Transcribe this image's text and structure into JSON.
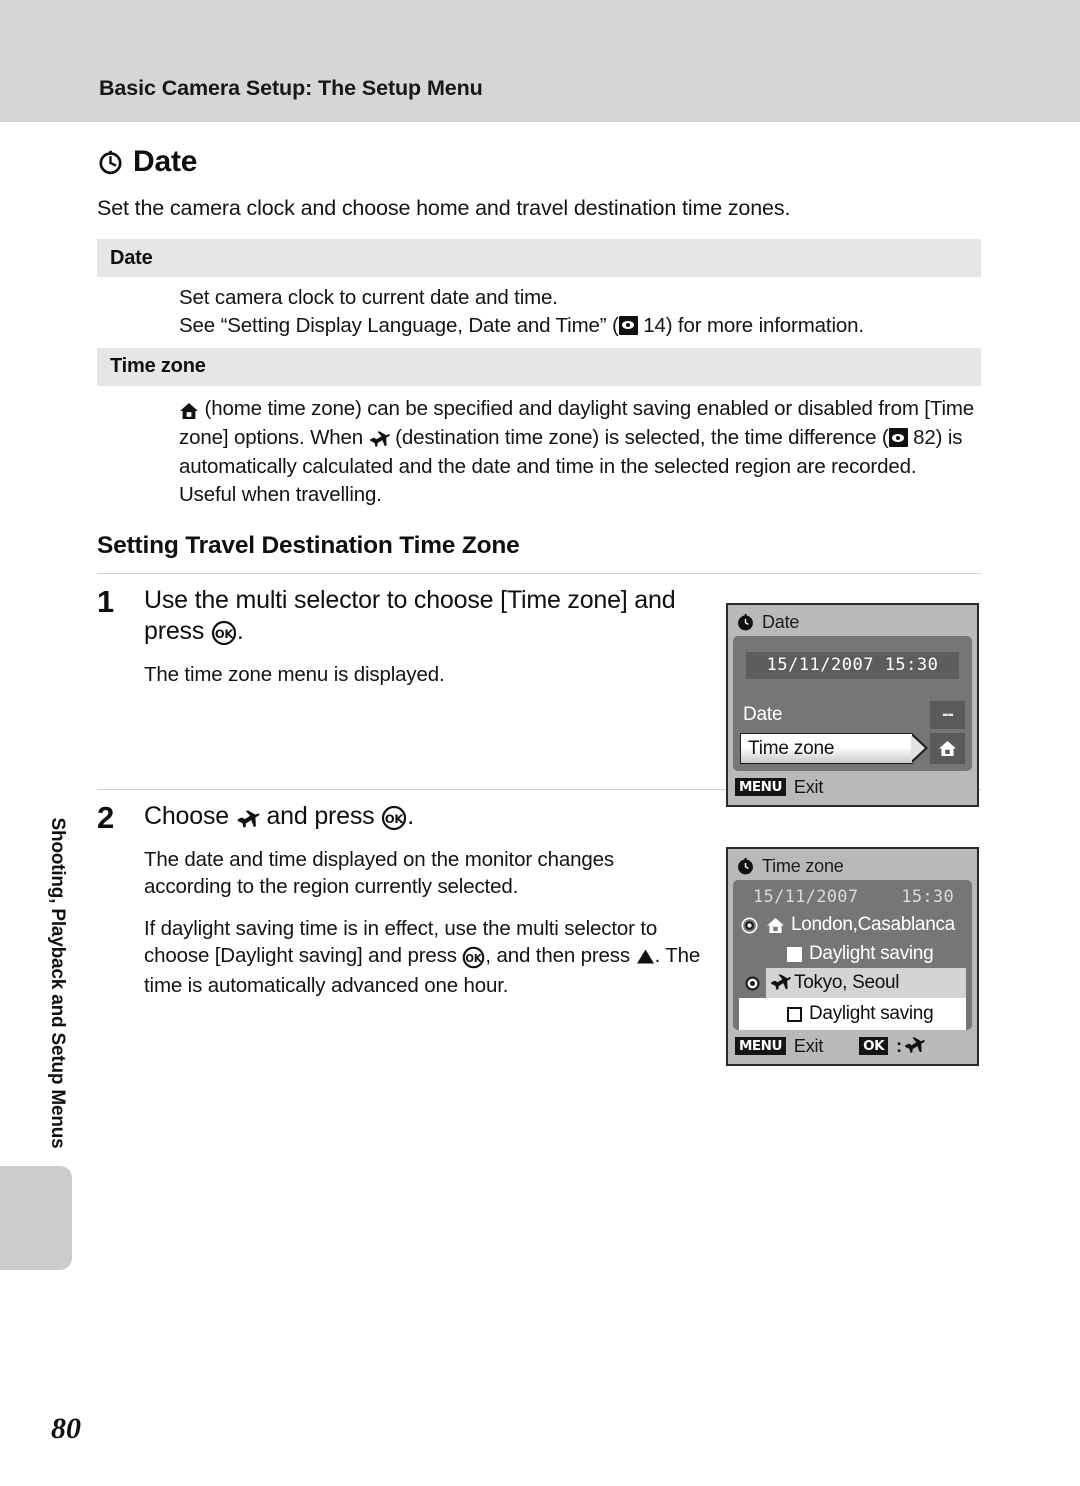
{
  "header": {
    "title": "Basic Camera Setup: The Setup Menu"
  },
  "side_tab": {
    "label": "Shooting, Playback and Setup Menus"
  },
  "page": {
    "number": "80"
  },
  "section": {
    "icon": "clock-icon",
    "title": "Date",
    "intro": "Set the camera clock and choose home and travel destination time zones."
  },
  "spec_table": {
    "rows": [
      {
        "header": "Date",
        "body_line1": "Set camera clock to current date and time.",
        "body_line2_pre": "See “Setting Display Language, Date and Time” (",
        "body_line2_ref": " 14) for more information.",
        "ref_icon": "book-reference-icon"
      },
      {
        "header": "Time zone",
        "p1_pre": " (home time zone) can be specified and daylight saving enabled or disabled from [Time zone] options. When ",
        "p1_mid": " (destination time zone) is selected, the time difference (",
        "p1_post": " 82) is automatically calculated and the date and time in the selected region are recorded. Useful when travelling.",
        "home_icon": "home-icon",
        "plane_icon": "airplane-icon",
        "ref_icon": "book-reference-icon"
      }
    ]
  },
  "sub_heading": "Setting Travel Destination Time Zone",
  "steps": [
    {
      "number": "1",
      "title_pre": "Use the multi selector to choose [Time zone] and press ",
      "title_post": ".",
      "ok_icon": "ok-button-icon",
      "sub": "The time zone menu is displayed."
    },
    {
      "number": "2",
      "title_pre": "Choose ",
      "title_mid": " and press ",
      "title_post": ".",
      "plane_icon": "airplane-icon",
      "ok_icon": "ok-button-icon",
      "sub1": "The date and time displayed on the monitor changes according to the region currently selected.",
      "sub2_a": "If daylight saving time is in effect, use the multi selector to choose [Daylight saving] and press ",
      "sub2_b": ", and then press ",
      "sub2_c": ". The time is automatically advanced one hour.",
      "up_icon": "triangle-up-icon"
    }
  ],
  "screens": [
    {
      "title": "Date",
      "title_icon": "clock-icon",
      "datetime": "15/11/2007  15:30",
      "date_label": "Date",
      "date_value": "--",
      "timezone_label": "Time zone",
      "timezone_icon": "home-icon",
      "bottom_menu_chip": "MENU",
      "bottom_menu_label": "Exit"
    },
    {
      "title": "Time zone",
      "title_icon": "clock-icon",
      "date": "15/11/2007",
      "time": "15:30",
      "home_city": "London,Casablanca",
      "home_dst_label": "Daylight saving",
      "dest_city": "Tokyo, Seoul",
      "dest_dst_label": "Daylight saving",
      "home_icon": "home-icon",
      "plane_icon": "airplane-icon",
      "bottom_menu_chip": "MENU",
      "bottom_menu_label": "Exit",
      "bottom_ok_chip": "OK",
      "bottom_ok_sep": ":"
    }
  ],
  "colors": {
    "header_band": "#d6d6d6",
    "table_header": "#e6e6e6",
    "screen_panel": "#767676",
    "screen_frame": "#b9b9b9",
    "side_tab": "#cccccc"
  }
}
